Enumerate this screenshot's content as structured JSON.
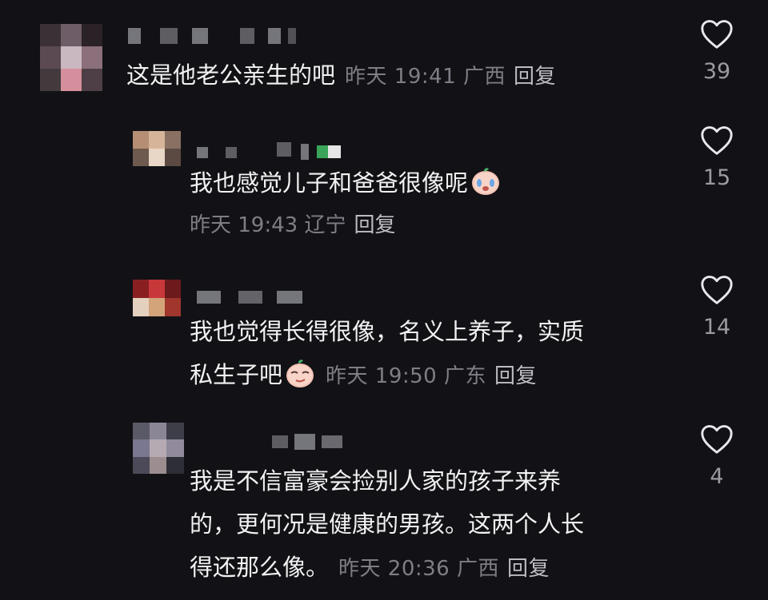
{
  "comments": [
    {
      "text": "这是他老公亲生的吧",
      "time": "昨天 19:41",
      "location": "广西",
      "reply": "回复",
      "likes": "39"
    },
    {
      "text": "我也感觉儿子和爸爸很像呢",
      "time": "昨天 19:43",
      "location": "辽宁",
      "reply": "回复",
      "likes": "15",
      "emoji": "crying-emoji"
    },
    {
      "text_line1": "我也觉得长得很像，名义上养子，实质",
      "text_line2": "私生子吧",
      "time": "昨天 19:50",
      "location": "广东",
      "reply": "回复",
      "likes": "14",
      "emoji": "smug-emoji"
    },
    {
      "text_line1": "我是不信富豪会捡别人家的孩子来养",
      "text_line2": "的，更何况是健康的男孩。这两个人长",
      "text_line3": "得还那么像。",
      "time": "昨天 20:36",
      "location": "广西",
      "reply": "回复",
      "likes": "4"
    }
  ],
  "colors": {
    "background": "#121216",
    "text": "#f2f2f2",
    "meta": "#7e7e86",
    "reply": "#bcbcc3"
  },
  "icons": [
    "heart-outline-icon"
  ]
}
